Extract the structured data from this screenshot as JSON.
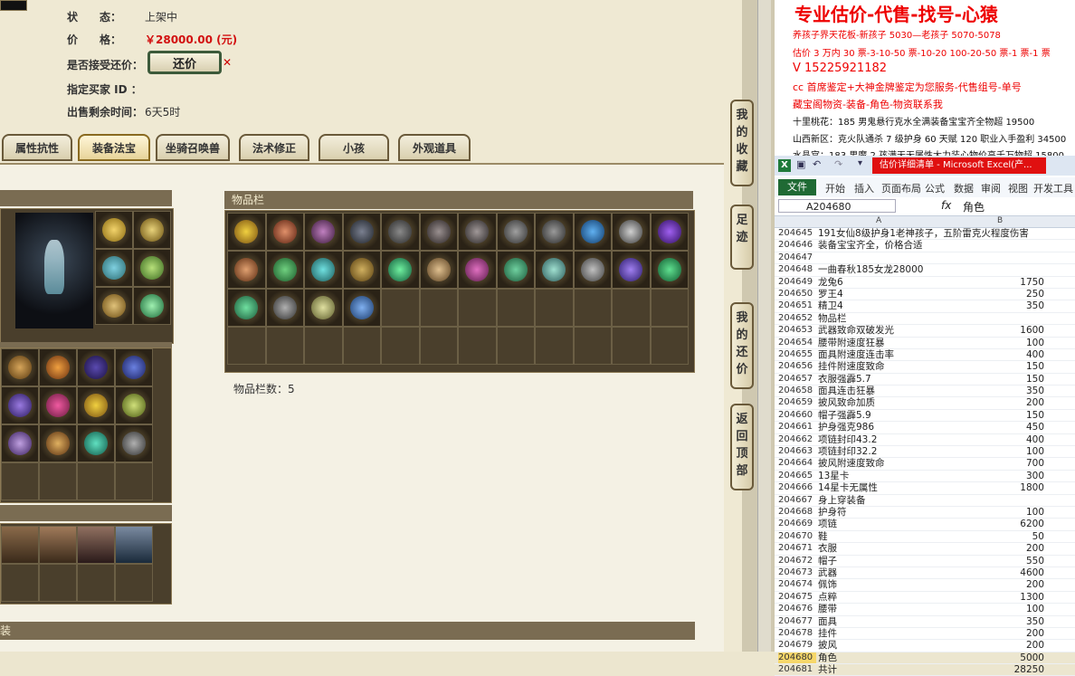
{
  "listing": {
    "status_label": "状　　态：",
    "status_value": "上架中",
    "price_label": "价　　格：",
    "price_value": "￥28000.00 (元)",
    "counter_label": "是否接受还价：",
    "counter_button": "还价",
    "buyer_label": "指定买家 ID ：",
    "time_label": "出售剩余时间：",
    "time_value": "6天5时"
  },
  "tabs": [
    "属性抗性",
    "装备法宝",
    "坐骑召唤兽",
    "法术修正",
    "小孩",
    "外观道具"
  ],
  "inventory": {
    "header": "物品栏",
    "count_label": "物品栏数：5"
  },
  "footer_label": "装",
  "side_buttons": [
    "我的收藏",
    "足迹",
    "我的还价",
    "返回顶部"
  ],
  "notepad": {
    "title": "专业估价-代售-找号-心猿",
    "lines": [
      "养孩子界天花板-新孩子 5030—老孩子 5070-5078",
      "估价 3 万内 30 票-3-10-50 票-10-20 100-20-50 票-1 票-1 票",
      "V 15225921182",
      "cc 首席鉴定+大神金牌鉴定为您服务-代售组号-单号",
      "藏宝阁物资-装备-角色-物资联系我",
      "十里桃花：185 男鬼悬行克水全满装备宝宝齐全物超 19500",
      "山西新区：克火队通杀 7 级护身 60 天赋 120 职业入手盈利 34500",
      "水晶宫：183 男魔 2 孩满天无属性大力装心物价高千万物超 15800"
    ]
  },
  "excel": {
    "title": "估价详细清单 - Microsoft Excel(产...",
    "file_tab": "文件",
    "menu": [
      "开始",
      "插入",
      "页面布局",
      "公式",
      "数据",
      "审阅",
      "视图",
      "开发工具"
    ],
    "name_box": "A204680",
    "fx": "fx",
    "formula_value": "角色",
    "col_a": "A",
    "col_b": "B",
    "rows": [
      {
        "n": "204645",
        "a": "191女仙8级护身1老神孩子，五阶雷克火程度伤害",
        "b": ""
      },
      {
        "n": "204646",
        "a": "装备宝宝齐全，价格合适",
        "b": ""
      },
      {
        "n": "204647",
        "a": "",
        "b": ""
      },
      {
        "n": "204648",
        "a": "一曲春秋185女龙28000",
        "b": ""
      },
      {
        "n": "204649",
        "a": "龙兔6",
        "b": "1750"
      },
      {
        "n": "204650",
        "a": "罗王4",
        "b": "250"
      },
      {
        "n": "204651",
        "a": "精卫4",
        "b": "350"
      },
      {
        "n": "204652",
        "a": "物品栏",
        "b": ""
      },
      {
        "n": "204653",
        "a": "武器致命双破发光",
        "b": "1600"
      },
      {
        "n": "204654",
        "a": "腰带附速度狂暴",
        "b": "100"
      },
      {
        "n": "204655",
        "a": "面具附速度连击率",
        "b": "400"
      },
      {
        "n": "204656",
        "a": "挂件附速度致命",
        "b": "150"
      },
      {
        "n": "204657",
        "a": "衣服强霹5.7",
        "b": "150"
      },
      {
        "n": "204658",
        "a": "面具连击狂暴",
        "b": "350"
      },
      {
        "n": "204659",
        "a": "披风致命加质",
        "b": "200"
      },
      {
        "n": "204660",
        "a": "帽子强霹5.9",
        "b": "150"
      },
      {
        "n": "204661",
        "a": "护身强克986",
        "b": "450"
      },
      {
        "n": "204662",
        "a": "项链封印43.2",
        "b": "400"
      },
      {
        "n": "204663",
        "a": "项链封印32.2",
        "b": "100"
      },
      {
        "n": "204664",
        "a": "披风附速度致命",
        "b": "700"
      },
      {
        "n": "204665",
        "a": "13星卡",
        "b": "300"
      },
      {
        "n": "204666",
        "a": "14星卡无属性",
        "b": "1800"
      },
      {
        "n": "204667",
        "a": "身上穿装备",
        "b": ""
      },
      {
        "n": "204668",
        "a": "护身符",
        "b": "100"
      },
      {
        "n": "204669",
        "a": "项链",
        "b": "6200"
      },
      {
        "n": "204670",
        "a": "鞋",
        "b": "50"
      },
      {
        "n": "204671",
        "a": "衣服",
        "b": "200"
      },
      {
        "n": "204672",
        "a": "帽子",
        "b": "550"
      },
      {
        "n": "204673",
        "a": "武器",
        "b": "4600"
      },
      {
        "n": "204674",
        "a": "佩饰",
        "b": "200"
      },
      {
        "n": "204675",
        "a": "点粹",
        "b": "1300"
      },
      {
        "n": "204676",
        "a": "腰带",
        "b": "100"
      },
      {
        "n": "204677",
        "a": "面具",
        "b": "350"
      },
      {
        "n": "204678",
        "a": "挂件",
        "b": "200"
      },
      {
        "n": "204679",
        "a": "披风",
        "b": "200"
      },
      {
        "n": "204680",
        "a": "角色",
        "b": "5000"
      },
      {
        "n": "204681",
        "a": "共计",
        "b": "28250"
      }
    ]
  },
  "colors": {
    "price": "#d21010",
    "notepad_red": "#e00000",
    "excel_green": "#1f6a34"
  }
}
